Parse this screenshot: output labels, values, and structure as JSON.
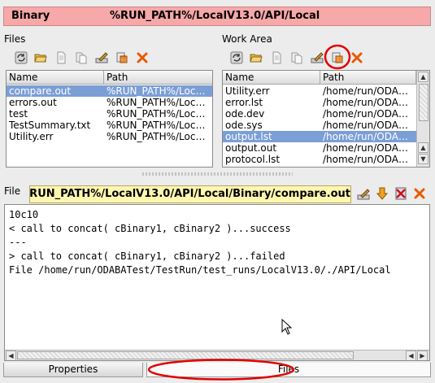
{
  "header": {
    "label": "Binary",
    "path": "%RUN_PATH%/LocalV13.0/API/Local"
  },
  "files_panel": {
    "title": "Files",
    "columns": [
      "Name",
      "Path"
    ],
    "rows": [
      {
        "name": "compare.out",
        "path": "%RUN_PATH%/Loc…",
        "selected": true
      },
      {
        "name": "errors.out",
        "path": "%RUN_PATH%/Loc…",
        "selected": false
      },
      {
        "name": "test",
        "path": "%RUN_PATH%/Loc…",
        "selected": false
      },
      {
        "name": "TestSummary.txt",
        "path": "%RUN_PATH%/Loc…",
        "selected": false
      },
      {
        "name": "Utility.err",
        "path": "%RUN_PATH%/Loc…",
        "selected": false
      }
    ]
  },
  "work_area": {
    "title": "Work Area",
    "columns": [
      "Name",
      "Path"
    ],
    "rows": [
      {
        "name": "Utility.err",
        "path": "/home/run/ODA…",
        "selected": false
      },
      {
        "name": "error.lst",
        "path": "/home/run/ODA…",
        "selected": false
      },
      {
        "name": "ode.dev",
        "path": "/home/run/ODA…",
        "selected": false
      },
      {
        "name": "ode.sys",
        "path": "/home/run/ODA…",
        "selected": false
      },
      {
        "name": "output.lst",
        "path": "/home/run/ODA…",
        "selected": true
      },
      {
        "name": "output.out",
        "path": "/home/run/ODA…",
        "selected": false
      },
      {
        "name": "protocol.lst",
        "path": "/home/run/ODA…",
        "selected": false
      }
    ]
  },
  "file_section": {
    "label": "File",
    "path": "%RUN_PATH%/LocalV13.0/API/Local/Binary/compare.out"
  },
  "editor": {
    "lines": [
      "10c10",
      "< call to concat( cBinary1, cBinary2 )...success",
      "---",
      "> call to concat( cBinary1, cBinary2 )...failed",
      "File /home/run/ODABATest/TestRun/test_runs/LocalV13.0/./API/Local"
    ]
  },
  "tabs": [
    {
      "label": "Properties",
      "active": false
    },
    {
      "label": "Files",
      "active": true
    }
  ],
  "icons": {
    "refresh": "refresh-icon",
    "open": "open-folder-icon",
    "copy": "copy-icon",
    "paste": "paste-icon",
    "edit": "edit-icon",
    "move": "move-icon",
    "delete": "delete-icon",
    "save": "save-icon",
    "down": "arrow-down-icon",
    "close": "close-icon"
  },
  "colors": {
    "header_bg": "#f7a8a8",
    "selection": "#7b9ed6",
    "path_field": "#fff6b0",
    "annotation": "#e00000"
  }
}
